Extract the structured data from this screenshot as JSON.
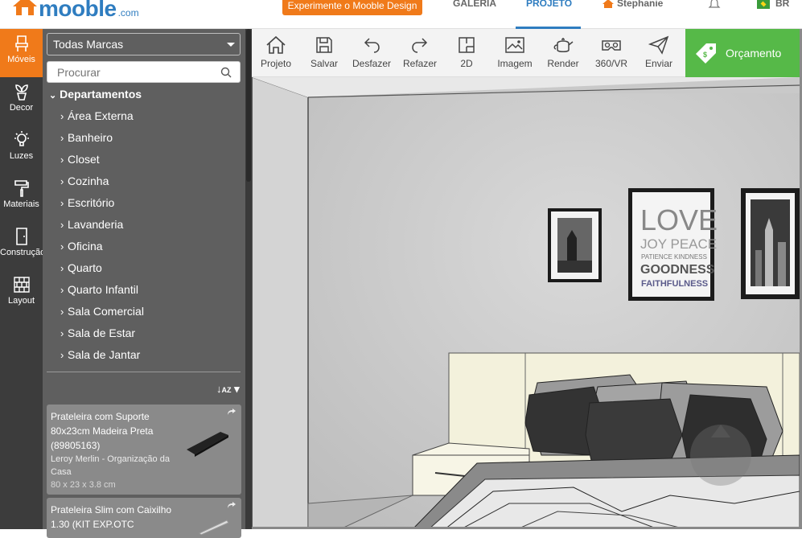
{
  "header": {
    "logo_text": "mooble",
    "logo_suffix": ".com",
    "promo_button": "Experimente o Mooble Design",
    "nav": {
      "gallery": "GALERIA",
      "project": "PROJETO",
      "user": "Stephanie",
      "language": "BR"
    }
  },
  "rail": {
    "items": [
      {
        "label": "Móveis",
        "icon": "chair-icon"
      },
      {
        "label": "Decor",
        "icon": "plant-icon"
      },
      {
        "label": "Luzes",
        "icon": "bulb-icon"
      },
      {
        "label": "Materiais",
        "icon": "paint-roller-icon"
      },
      {
        "label": "Construção",
        "icon": "door-icon"
      },
      {
        "label": "Layout",
        "icon": "brick-wall-icon"
      }
    ]
  },
  "catalog": {
    "brand_selected": "Todas Marcas",
    "search_placeholder": "Procurar",
    "departments_heading": "Departamentos",
    "departments": [
      "Área Externa",
      "Banheiro",
      "Closet",
      "Cozinha",
      "Escritório",
      "Lavanderia",
      "Oficina",
      "Quarto",
      "Quarto Infantil",
      "Sala Comercial",
      "Sala de Estar",
      "Sala de Jantar"
    ],
    "products": [
      {
        "title": "Prateleira com Suporte 80x23cm Madeira Preta (89805163)",
        "brand": "Leroy Merlin - Organização da Casa",
        "dims": "80 x 23 x 3.8 cm"
      },
      {
        "title": "Prateleira Slim com Caixilho 1.30 (KIT EXP.OTC",
        "brand": "",
        "dims": ""
      }
    ]
  },
  "toolbar": {
    "items": [
      {
        "label": "Projeto",
        "icon": "home-icon"
      },
      {
        "label": "Salvar",
        "icon": "save-icon"
      },
      {
        "label": "Desfazer",
        "icon": "undo-icon"
      },
      {
        "label": "Refazer",
        "icon": "redo-icon"
      },
      {
        "label": "2D",
        "icon": "floorplan-icon"
      },
      {
        "label": "Imagem",
        "icon": "image-icon"
      },
      {
        "label": "Render",
        "icon": "teapot-icon"
      },
      {
        "label": "360/VR",
        "icon": "vr-headset-icon"
      },
      {
        "label": "Enviar",
        "icon": "send-icon"
      }
    ],
    "quote_button": "Orçamento"
  },
  "scene": {
    "poster_text": [
      "LOVE",
      "JOY PEACE",
      "PATIENCE KINDNESS",
      "GOODNESS",
      "FAITHFULNESS"
    ]
  },
  "colors": {
    "brand_blue": "#2f7dc0",
    "accent_orange": "#f07a1a",
    "quote_green": "#56b948",
    "panel_gray": "#5f5f5f",
    "rail_dark": "#3c3c3c"
  }
}
